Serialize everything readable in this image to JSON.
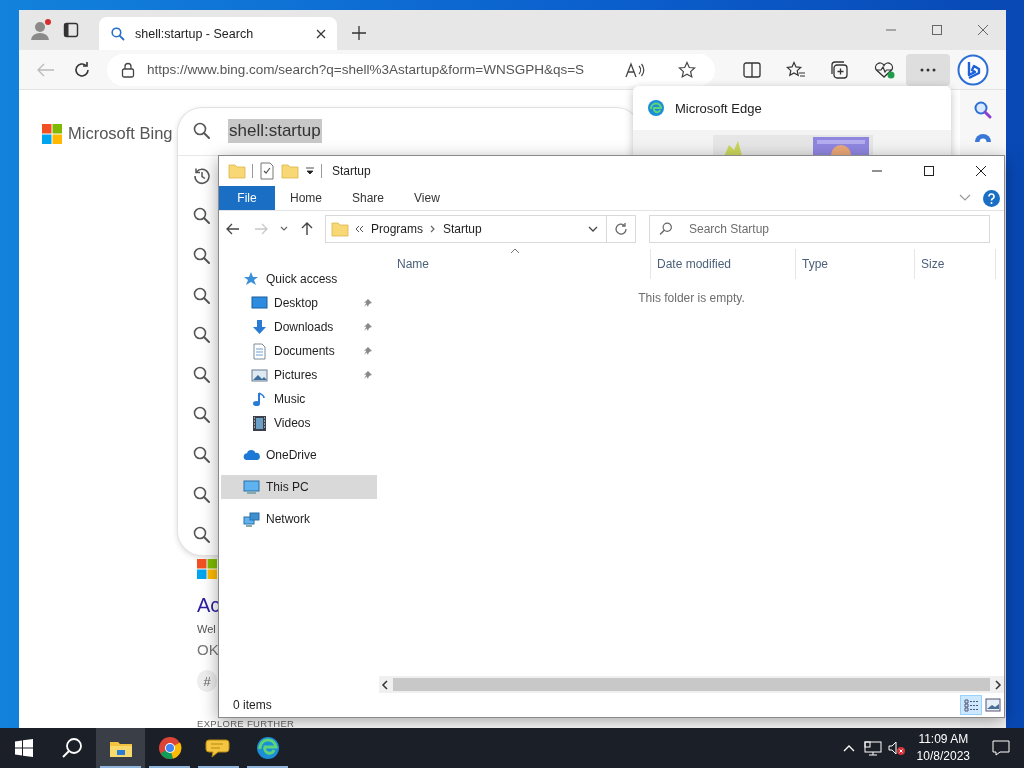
{
  "browser": {
    "tabs": [
      {
        "title": "shell:startup - Search",
        "selected": true
      }
    ],
    "back": {
      "disabled": true
    },
    "address": "https://www.bing.com/search?q=shell%3Astartup&form=WNSGPH&qs=S",
    "more_menu_open": true,
    "edge_menu": {
      "title": "Microsoft Edge"
    },
    "page": {
      "logo": "Microsoft Bing",
      "search": {
        "value": "shell:startup",
        "highlighted": true
      },
      "suggestions": [
        {
          "kind": "history"
        },
        {
          "kind": "search"
        },
        {
          "kind": "search"
        },
        {
          "kind": "search"
        },
        {
          "kind": "search"
        },
        {
          "kind": "search"
        },
        {
          "kind": "search"
        },
        {
          "kind": "search"
        },
        {
          "kind": "search"
        },
        {
          "kind": "search"
        }
      ],
      "result": {
        "title": "Ac",
        "source": "Wel",
        "snippet": "OK",
        "chip": "#"
      },
      "explore": "EXPLORE FURTHER"
    }
  },
  "explorer": {
    "title": "Startup",
    "ribbon_tabs": [
      {
        "label": "File",
        "kind": "menu"
      },
      {
        "label": "Home",
        "kind": "tab"
      },
      {
        "label": "Share",
        "kind": "tab"
      },
      {
        "label": "View",
        "kind": "tab"
      }
    ],
    "forward": {
      "disabled": true
    },
    "path": [
      "Programs",
      "Startup"
    ],
    "search": {
      "placeholder": "Search Startup"
    },
    "nav": [
      {
        "label": "Quick access",
        "selected": false,
        "children": [
          {
            "label": "Desktop",
            "pinned": true,
            "selected": false
          },
          {
            "label": "Downloads",
            "pinned": true,
            "selected": false
          },
          {
            "label": "Documents",
            "pinned": true,
            "selected": false
          },
          {
            "label": "Pictures",
            "pinned": true,
            "selected": false
          },
          {
            "label": "Music",
            "pinned": false,
            "selected": false
          },
          {
            "label": "Videos",
            "pinned": false,
            "selected": false
          }
        ]
      },
      {
        "label": "OneDrive",
        "selected": false
      },
      {
        "label": "This PC",
        "selected": true
      },
      {
        "label": "Network",
        "selected": false
      }
    ],
    "columns": [
      {
        "label": "Name",
        "sorted": true
      },
      {
        "label": "Date modified",
        "sorted": false
      },
      {
        "label": "Type",
        "sorted": false
      },
      {
        "label": "Size",
        "sorted": false
      }
    ],
    "empty_message": "This folder is empty.",
    "status": "0 items",
    "views": [
      {
        "selected": true
      },
      {
        "selected": false
      }
    ]
  },
  "taskbar": {
    "apps": [
      {
        "selected": true,
        "running": true
      },
      {
        "selected": false,
        "running": true
      },
      {
        "selected": false,
        "running": true
      },
      {
        "selected": false,
        "running": true
      }
    ],
    "volume_muted": true,
    "clock": {
      "time": "11:09 AM",
      "date": "10/8/2023"
    }
  }
}
